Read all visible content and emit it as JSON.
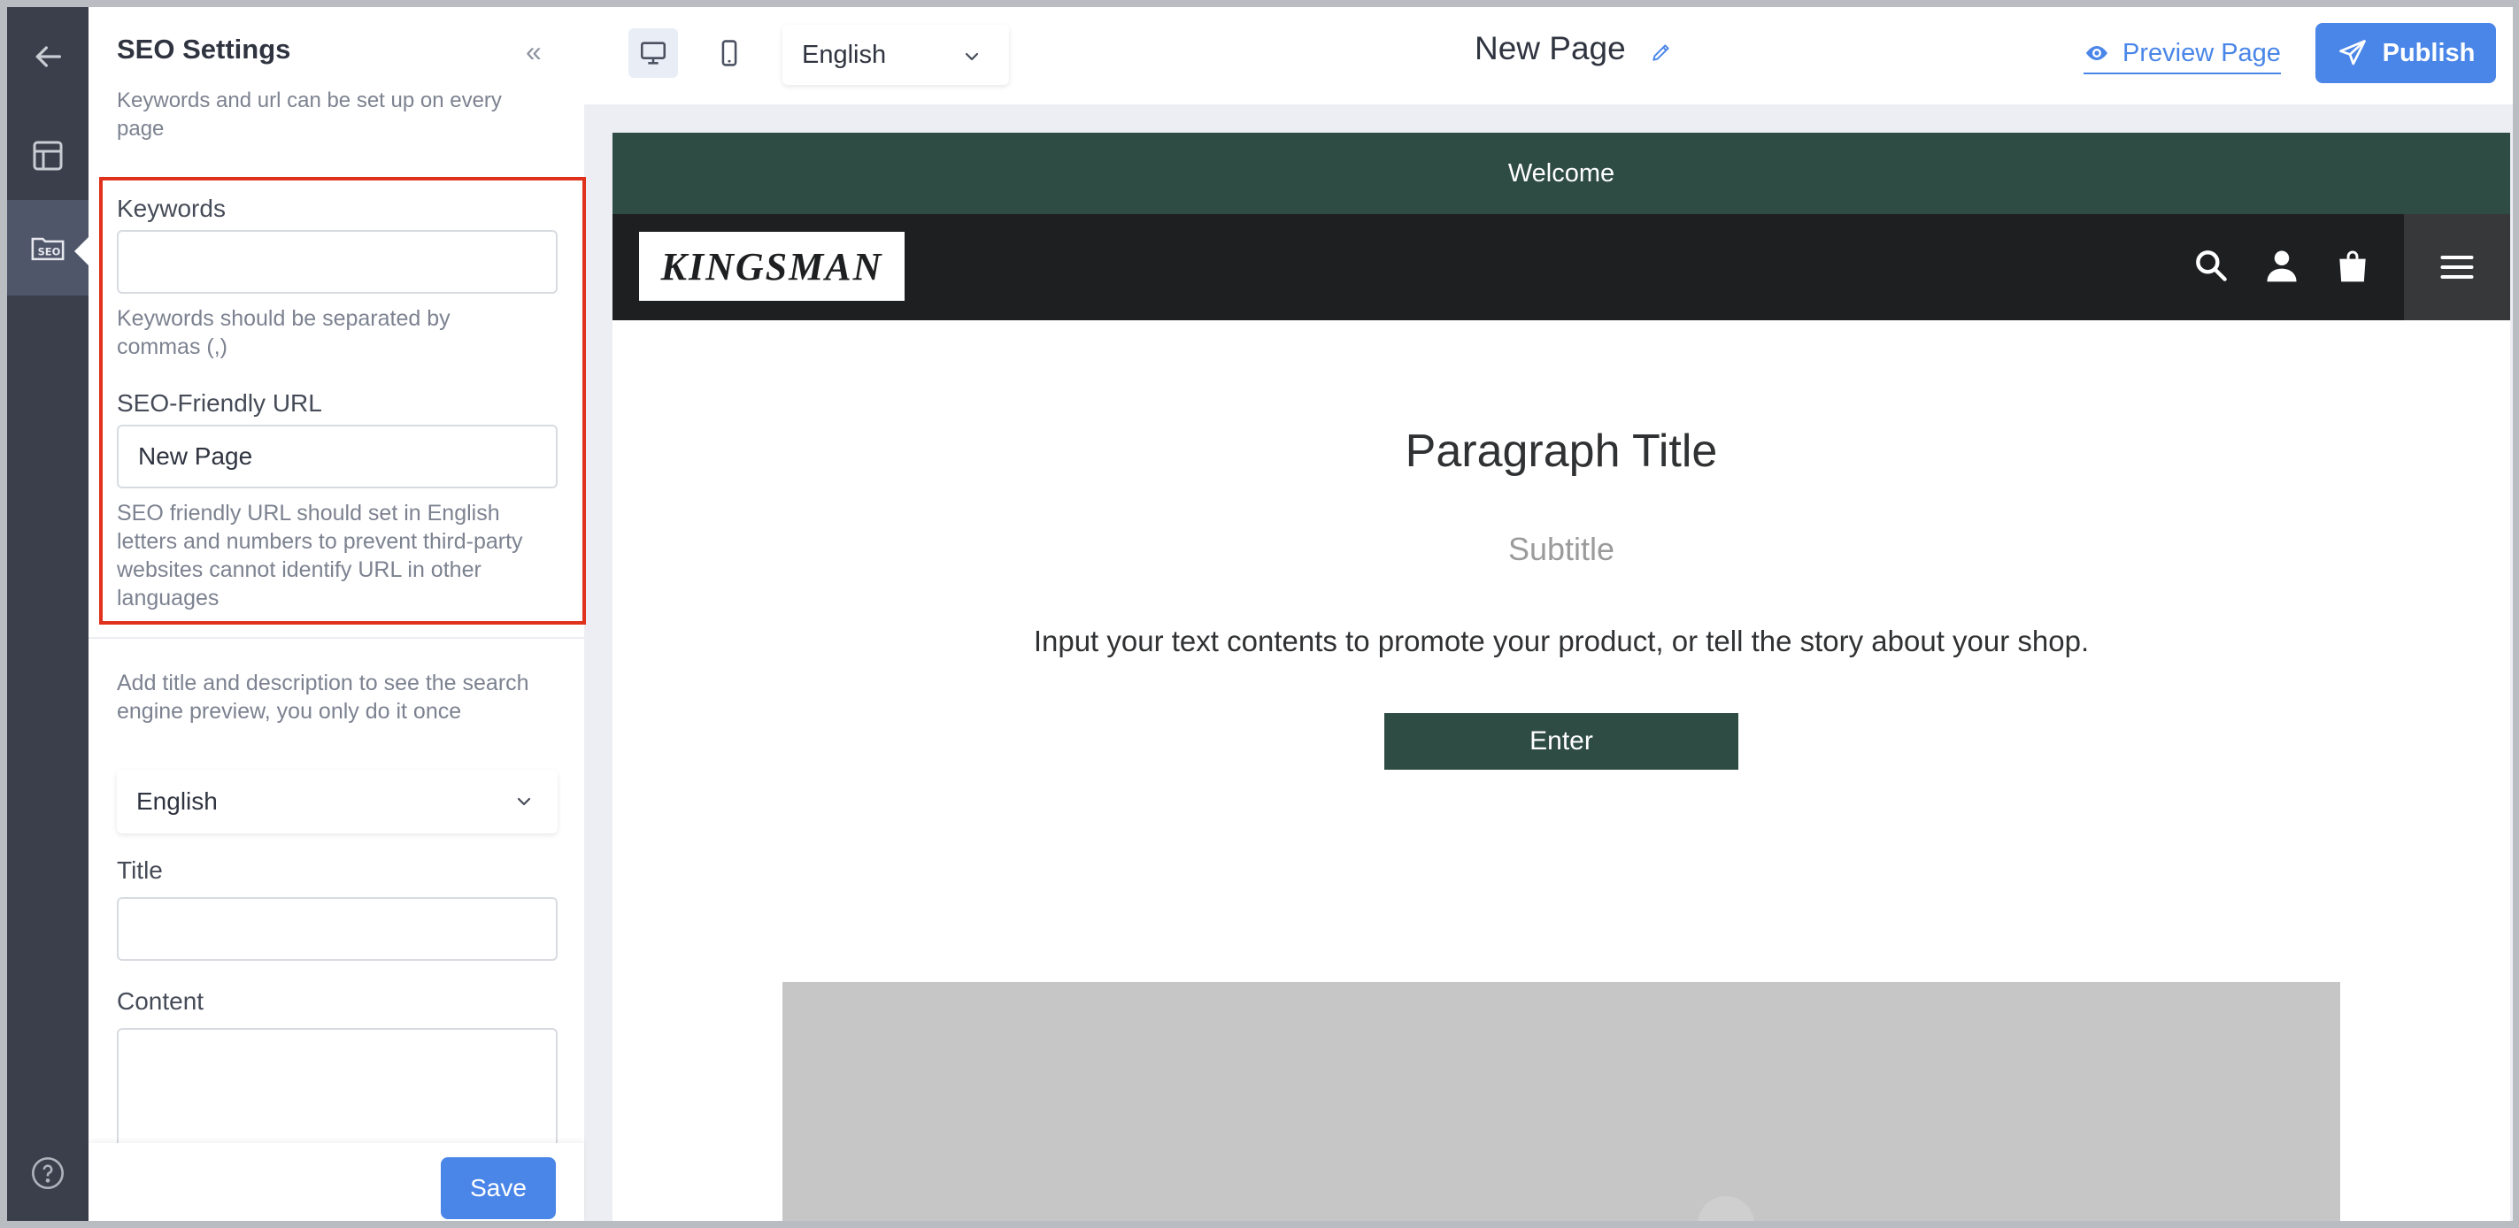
{
  "sidebar_rail": {
    "items": [
      {
        "name": "back-arrow-icon"
      },
      {
        "name": "layout-icon"
      },
      {
        "name": "seo-folder-icon",
        "active": true
      }
    ],
    "help_icon": "help-circle-icon"
  },
  "seo_panel": {
    "title": "SEO Settings",
    "collapse_glyph": "«",
    "description": "Keywords and url can be set up on every page",
    "keywords": {
      "label": "Keywords",
      "value": "",
      "hint": "Keywords should be separated by commas (,)"
    },
    "url": {
      "label": "SEO-Friendly URL",
      "value": "New Page",
      "hint": "SEO friendly URL should set in English letters and numbers to prevent third-party websites cannot identify URL in other languages"
    },
    "preview_note": "Add title and description to see the search engine preview, you only do it once",
    "language_select": "English",
    "title_field": {
      "label": "Title",
      "value": ""
    },
    "content_field": {
      "label": "Content",
      "value": ""
    },
    "save_label": "Save"
  },
  "toolbar": {
    "language": "English",
    "page_name": "New Page",
    "preview_label": "Preview Page",
    "publish_label": "Publish"
  },
  "canvas": {
    "welcome_bar": "Welcome",
    "logo_text": "KINGSMAN",
    "paragraph_title": "Paragraph Title",
    "subtitle": "Subtitle",
    "body_text": "Input your text contents to promote your product, or tell the story about your shop.",
    "button_label": "Enter"
  },
  "colors": {
    "accent": "#4a86e8",
    "highlight_border": "#e0311d",
    "store_green": "#2e4b44",
    "store_nav": "#1e1f20",
    "rail": "#3a3f4b"
  }
}
